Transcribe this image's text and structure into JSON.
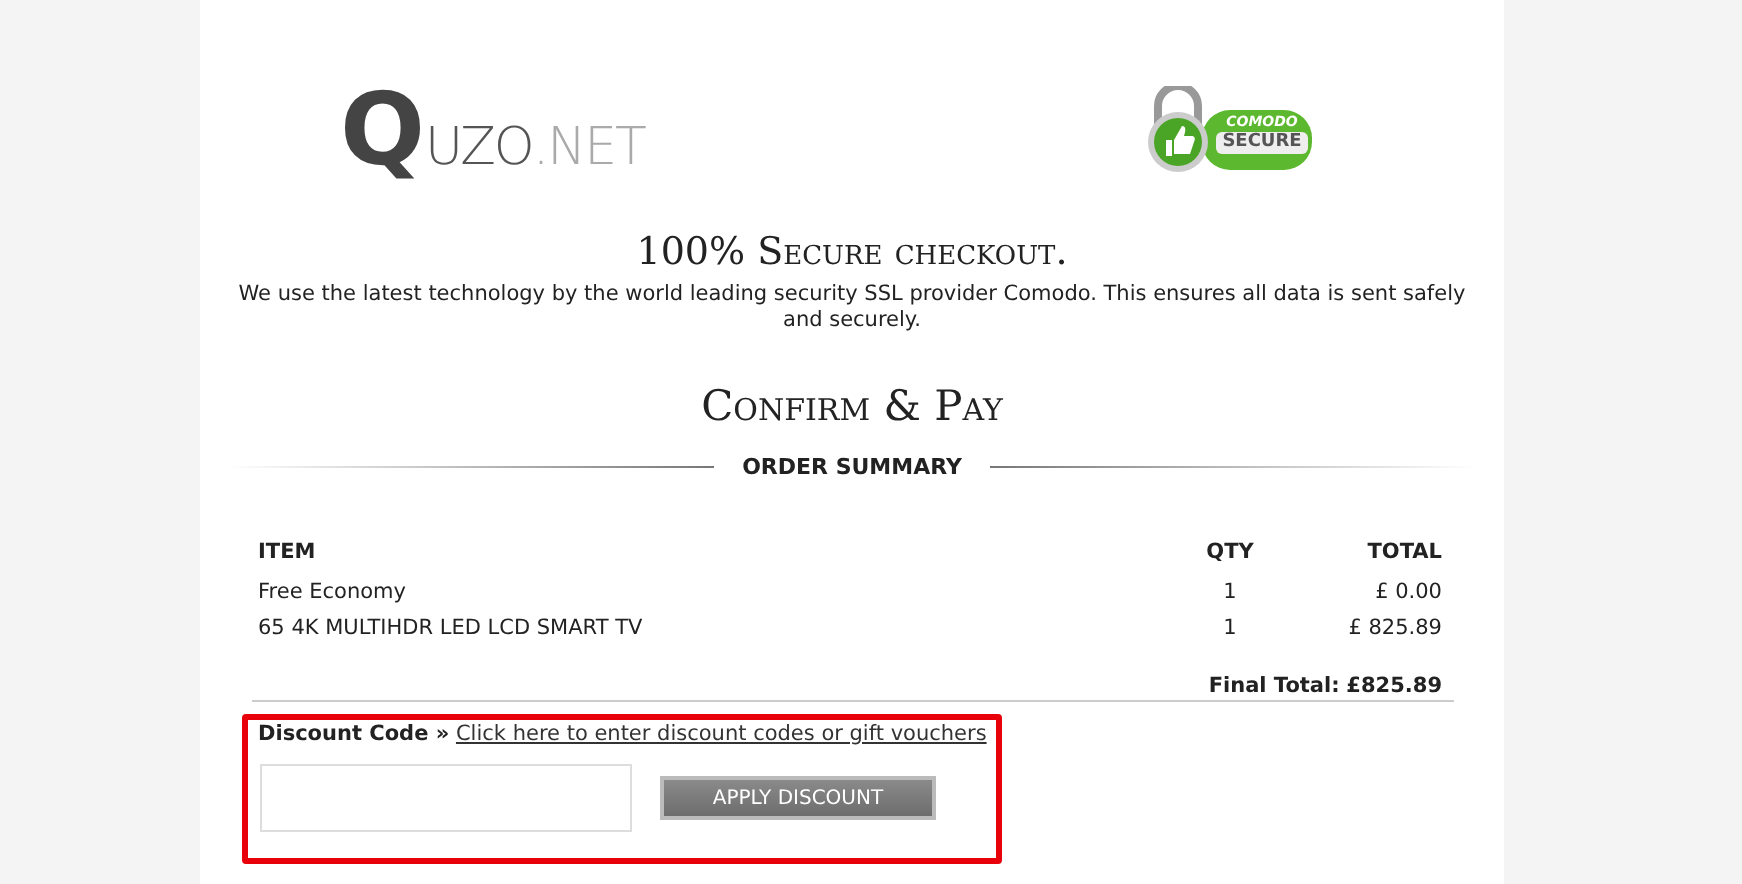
{
  "logo": {
    "mark": "Q",
    "name": "UZO",
    "suffix": ".NET"
  },
  "badge": {
    "brand": "COMODO",
    "label": "SECURE"
  },
  "heading": "100% Secure checkout.",
  "intro": "We use the latest technology by the world leading security SSL provider Comodo. This ensures all data is sent safely and securely.",
  "title": "Confirm & Pay",
  "summary": {
    "title": "ORDER SUMMARY",
    "columns": [
      "ITEM",
      "QTY",
      "TOTAL"
    ],
    "rows": [
      {
        "item": "Free Economy",
        "qty": "1",
        "total": "£ 0.00"
      },
      {
        "item": "65 4K MULTIHDR LED LCD SMART TV",
        "qty": "1",
        "total": "£ 825.89"
      }
    ],
    "final_label": "Final Total:",
    "final_value": "£825.89"
  },
  "discount": {
    "label": "Discount Code »",
    "link": "Click here to enter discount codes or gift vouchers",
    "button": "APPLY DISCOUNT"
  }
}
